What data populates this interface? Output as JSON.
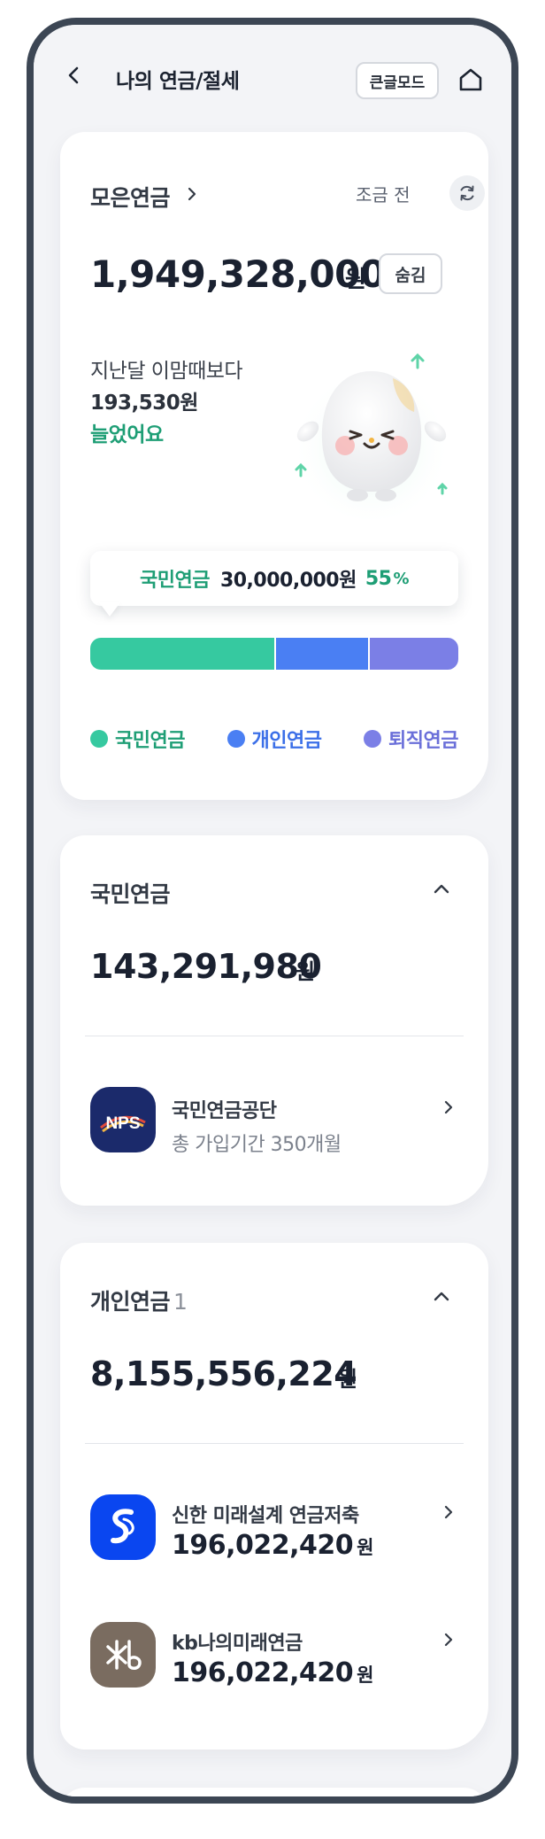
{
  "header": {
    "title": "나의 연금/절세",
    "big_mode_label": "큰글모드"
  },
  "total": {
    "title": "모은연금",
    "updated_label": "조금 전",
    "amount": "1,949,328,000",
    "currency": "원",
    "hide_label": "숨김",
    "compare_line1": "지난달 이맘때보다",
    "compare_amount": "193,530원",
    "compare_result": "늘었어요",
    "tooltip": {
      "label": "국민연금",
      "amount": "30,000,000원",
      "percent": "55",
      "percent_sign": "%"
    },
    "distribution": [
      {
        "name": "국민연금",
        "share": 0.5,
        "color": "#36c9a0"
      },
      {
        "name": "개인연금",
        "share": 0.255,
        "color": "#4a7ff3"
      },
      {
        "name": "퇴직연금",
        "share": 0.245,
        "color": "#7b7fe6"
      }
    ],
    "legend": [
      {
        "label": "국민연금",
        "color": "#36c9a0",
        "text_color": "#1e9e75"
      },
      {
        "label": "개인연금",
        "color": "#4a7ff3",
        "text_color": "#3b6fe8"
      },
      {
        "label": "퇴직연금",
        "color": "#7b7fe6",
        "text_color": "#6a6fd9"
      }
    ]
  },
  "national": {
    "title": "국민연금",
    "amount": "143,291,980",
    "currency": "원",
    "institution": {
      "name": "국민연금공단",
      "sub": "총 가입기간 350개월",
      "logo_text": "NPS",
      "logo_color": "#1b2a6b"
    }
  },
  "personal": {
    "title": "개인연금",
    "count": "1",
    "amount": "8,155,556,224",
    "currency": "원",
    "accounts": [
      {
        "name": "신한 미래설계 연금저축",
        "amount": "196,022,420",
        "currency": "원",
        "logo_color": "#0a46f0"
      },
      {
        "name": "kb나의미래연금",
        "amount": "196,022,420",
        "currency": "원",
        "logo_color": "#7a6c60"
      }
    ]
  }
}
